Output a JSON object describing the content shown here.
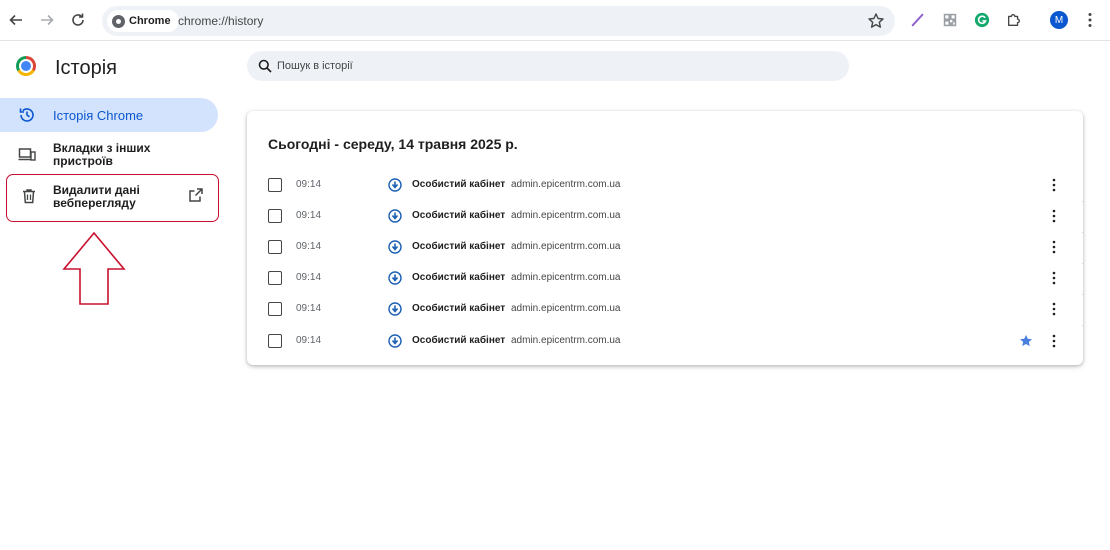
{
  "browser": {
    "chip_label": "Chrome",
    "url": "chrome://history",
    "avatar_letter": "M",
    "colors": {
      "accent": "#0b57d0",
      "highlight": "#d3e3fd",
      "omnibox": "#eef1f6",
      "annotation": "#c8102e"
    }
  },
  "sidebar": {
    "title": "Історія",
    "items": [
      {
        "icon": "history-icon",
        "label": "Історія Chrome",
        "active": true
      },
      {
        "icon": "devices-icon",
        "label_lines": [
          "Вкладки з інших",
          "пристроїв"
        ]
      },
      {
        "icon": "trash-icon",
        "label_lines": [
          "Видалити дані",
          "вебперегляду"
        ],
        "trailing_icon": "open-in-new-icon"
      }
    ]
  },
  "search": {
    "placeholder": "Пошук в історії"
  },
  "history": {
    "date_heading": "Сьогодні - середу, 14 травня 2025 р.",
    "entries": [
      {
        "time": "09:14",
        "title": "Особистий кабінет",
        "domain": "admin.epicentrm.com.ua",
        "starred": false
      },
      {
        "time": "09:14",
        "title": "Особистий кабінет",
        "domain": "admin.epicentrm.com.ua",
        "starred": false
      },
      {
        "time": "09:14",
        "title": "Особистий кабінет",
        "domain": "admin.epicentrm.com.ua",
        "starred": false
      },
      {
        "time": "09:14",
        "title": "Особистий кабінет",
        "domain": "admin.epicentrm.com.ua",
        "starred": false
      },
      {
        "time": "09:14",
        "title": "Особистий кабінет",
        "domain": "admin.epicentrm.com.ua",
        "starred": false
      },
      {
        "time": "09:14",
        "title": "Особистий кабінет",
        "domain": "admin.epicentrm.com.ua",
        "starred": true
      }
    ]
  }
}
